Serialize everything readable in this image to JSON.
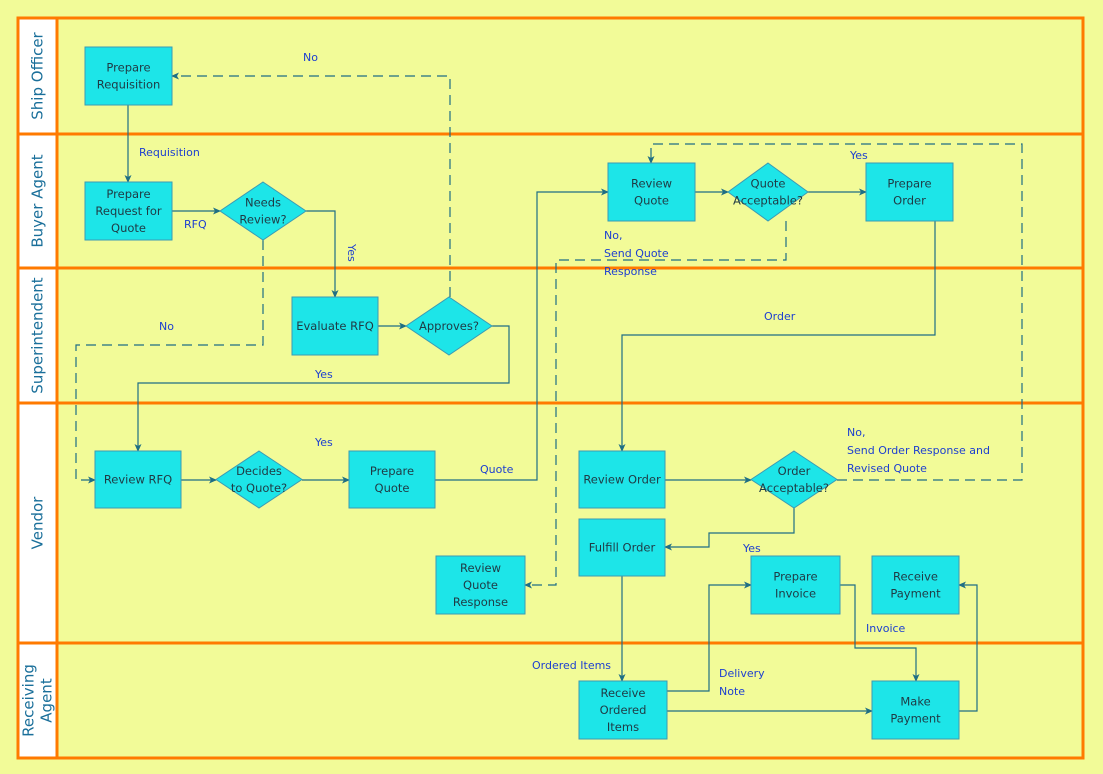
{
  "diagram": {
    "type": "cross-functional flowchart",
    "colors": {
      "background": "#f2fb98",
      "lane_border": "#ff7a00",
      "lane_header": "#ffffff",
      "lane_title": "#1a6f9a",
      "node_fill": "#1de5e8",
      "node_stroke": "#3a9ab5",
      "node_text": "#1f3a44",
      "connector": "#1f6e84",
      "label_text": "#1d3fd0"
    },
    "lanes": [
      {
        "id": "ship-officer",
        "title": [
          "Ship Officer"
        ]
      },
      {
        "id": "buyer-agent",
        "title": [
          "Buyer Agent"
        ]
      },
      {
        "id": "superintendent",
        "title": [
          "Superintendent"
        ]
      },
      {
        "id": "vendor",
        "title": [
          "Vendor"
        ]
      },
      {
        "id": "receiving-agent",
        "title": [
          "Receiving",
          "Agent"
        ]
      }
    ],
    "nodes": [
      {
        "id": "prepare-requisition",
        "shape": "process",
        "lane": "ship-officer",
        "lines": [
          "Prepare",
          "Requisition"
        ]
      },
      {
        "id": "prepare-request-for-quote",
        "shape": "process",
        "lane": "buyer-agent",
        "lines": [
          "Prepare",
          "Request for",
          "Quote"
        ]
      },
      {
        "id": "needs-review",
        "shape": "decision",
        "lane": "buyer-agent",
        "lines": [
          "Needs",
          "Review?"
        ]
      },
      {
        "id": "review-quote",
        "shape": "process",
        "lane": "buyer-agent",
        "lines": [
          "Review",
          "Quote"
        ]
      },
      {
        "id": "quote-acceptable",
        "shape": "decision",
        "lane": "buyer-agent",
        "lines": [
          "Quote",
          "Acceptable?"
        ]
      },
      {
        "id": "prepare-order",
        "shape": "process",
        "lane": "buyer-agent",
        "lines": [
          "Prepare",
          "Order"
        ]
      },
      {
        "id": "evaluate-rfq",
        "shape": "process",
        "lane": "superintendent",
        "lines": [
          "Evaluate RFQ"
        ]
      },
      {
        "id": "approves",
        "shape": "decision",
        "lane": "superintendent",
        "lines": [
          "Approves?"
        ]
      },
      {
        "id": "review-rfq",
        "shape": "process",
        "lane": "vendor",
        "lines": [
          "Review RFQ"
        ]
      },
      {
        "id": "decides-to-quote",
        "shape": "decision",
        "lane": "vendor",
        "lines": [
          "Decides",
          "to Quote?"
        ]
      },
      {
        "id": "prepare-quote",
        "shape": "process",
        "lane": "vendor",
        "lines": [
          "Prepare",
          "Quote"
        ]
      },
      {
        "id": "review-order",
        "shape": "process",
        "lane": "vendor",
        "lines": [
          "Review Order"
        ]
      },
      {
        "id": "order-acceptable",
        "shape": "decision",
        "lane": "vendor",
        "lines": [
          "Order",
          "Acceptable?"
        ]
      },
      {
        "id": "fulfill-order",
        "shape": "process",
        "lane": "vendor",
        "lines": [
          "Fulfill Order"
        ]
      },
      {
        "id": "review-quote-response",
        "shape": "process",
        "lane": "vendor",
        "lines": [
          "Review",
          "Quote",
          "Response"
        ]
      },
      {
        "id": "prepare-invoice",
        "shape": "process",
        "lane": "vendor",
        "lines": [
          "Prepare",
          "Invoice"
        ]
      },
      {
        "id": "receive-payment",
        "shape": "process",
        "lane": "vendor",
        "lines": [
          "Receive",
          "Payment"
        ]
      },
      {
        "id": "receive-ordered-items",
        "shape": "process",
        "lane": "receiving-agent",
        "lines": [
          "Receive",
          "Ordered",
          "Items"
        ]
      },
      {
        "id": "make-payment",
        "shape": "process",
        "lane": "receiving-agent",
        "lines": [
          "Make",
          "Payment"
        ]
      }
    ],
    "connectors": [
      {
        "id": "requisition",
        "from": "prepare-requisition",
        "to": "prepare-request-for-quote",
        "style": "solid",
        "label": [
          "Requisition"
        ]
      },
      {
        "id": "rfq",
        "from": "prepare-request-for-quote",
        "to": "needs-review",
        "style": "solid",
        "label": [
          "RFQ"
        ]
      },
      {
        "id": "needs-review-yes",
        "from": "needs-review",
        "to": "evaluate-rfq",
        "style": "solid",
        "label": [
          "Yes"
        ]
      },
      {
        "id": "needs-review-no",
        "from": "needs-review",
        "to": "review-rfq",
        "style": "dashed",
        "label": [
          "No"
        ]
      },
      {
        "id": "evaluate-to-approves",
        "from": "evaluate-rfq",
        "to": "approves",
        "style": "solid",
        "label": []
      },
      {
        "id": "approves-no",
        "from": "approves",
        "to": "prepare-requisition",
        "style": "dashed",
        "label": [
          "No"
        ]
      },
      {
        "id": "approves-yes",
        "from": "approves",
        "to": "review-rfq",
        "style": "solid",
        "label": [
          "Yes"
        ]
      },
      {
        "id": "review-rfq-to-decides",
        "from": "review-rfq",
        "to": "decides-to-quote",
        "style": "solid",
        "label": []
      },
      {
        "id": "decides-yes",
        "from": "decides-to-quote",
        "to": "prepare-quote",
        "style": "solid",
        "label": [
          "Yes"
        ]
      },
      {
        "id": "quote",
        "from": "prepare-quote",
        "to": "review-quote",
        "style": "solid",
        "label": [
          "Quote"
        ]
      },
      {
        "id": "review-quote-to-acceptable",
        "from": "review-quote",
        "to": "quote-acceptable",
        "style": "solid",
        "label": []
      },
      {
        "id": "quote-acceptable-yes",
        "from": "quote-acceptable",
        "to": "prepare-order",
        "style": "solid",
        "label": [
          "Yes"
        ]
      },
      {
        "id": "quote-acceptable-no",
        "from": "quote-acceptable",
        "to": "review-quote-response",
        "style": "dashed",
        "label": [
          "No,",
          "Send Quote",
          "Response"
        ]
      },
      {
        "id": "order",
        "from": "prepare-order",
        "to": "review-order",
        "style": "solid",
        "label": [
          "Order"
        ]
      },
      {
        "id": "review-order-to-acceptable",
        "from": "review-order",
        "to": "order-acceptable",
        "style": "solid",
        "label": []
      },
      {
        "id": "order-acceptable-no",
        "from": "order-acceptable",
        "to": "review-quote",
        "style": "dashed",
        "label": [
          "No,",
          "Send Order Response and",
          "Revised Quote"
        ]
      },
      {
        "id": "order-acceptable-yes",
        "from": "order-acceptable",
        "to": "fulfill-order",
        "style": "solid",
        "label": [
          "Yes"
        ]
      },
      {
        "id": "ordered-items",
        "from": "fulfill-order",
        "to": "receive-ordered-items",
        "style": "solid",
        "label": [
          "Ordered Items"
        ]
      },
      {
        "id": "delivery-note",
        "from": "receive-ordered-items",
        "to": "prepare-invoice",
        "style": "solid",
        "label": [
          "Delivery",
          "Note"
        ]
      },
      {
        "id": "received-to-payment",
        "from": "receive-ordered-items",
        "to": "make-payment",
        "style": "solid",
        "label": []
      },
      {
        "id": "invoice",
        "from": "prepare-invoice",
        "to": "make-payment",
        "style": "solid",
        "label": [
          "Invoice"
        ]
      },
      {
        "id": "payment",
        "from": "make-payment",
        "to": "receive-payment",
        "style": "solid",
        "label": []
      }
    ]
  }
}
